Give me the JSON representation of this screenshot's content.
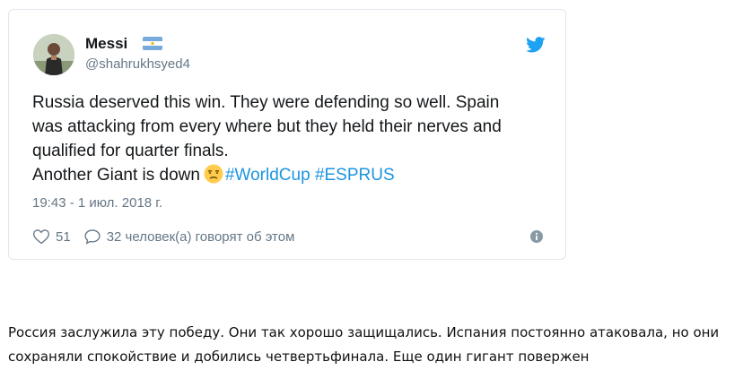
{
  "tweet": {
    "author": {
      "name": "Messi",
      "handle": "@shahrukhsyed4"
    },
    "text_lines": [
      "Russia deserved this win. They were defending so well. Spain",
      "was attacking from every where but they held their nerves and",
      "qualified for quarter finals."
    ],
    "last_line_text": "Another Giant is down",
    "hashtags": [
      "#WorldCup",
      "#ESPRUS"
    ],
    "timestamp": "19:43 - 1 июл. 2018 г.",
    "likes": "51",
    "replies_text": "32 человек(а) говорят об этом",
    "icons": {
      "bird": "twitter-bird-icon",
      "like": "heart-icon",
      "reply": "speech-bubble-icon",
      "info": "info-icon",
      "emoji": "unamused-face-emoji",
      "flag": "argentina-flag"
    },
    "colors": {
      "accent": "#1da1f2",
      "hashtag": "#1b95e0",
      "muted": "#657786",
      "text": "#14171a",
      "border": "#e1e8ed"
    }
  },
  "translation": {
    "lines": [
      "Россия заслужила эту победу. Они так хорошо защищались. Испания постоянно атаковала, но они",
      "сохраняли спокойствие и добились четвертьфинала. Еще один гигант повержен"
    ]
  }
}
